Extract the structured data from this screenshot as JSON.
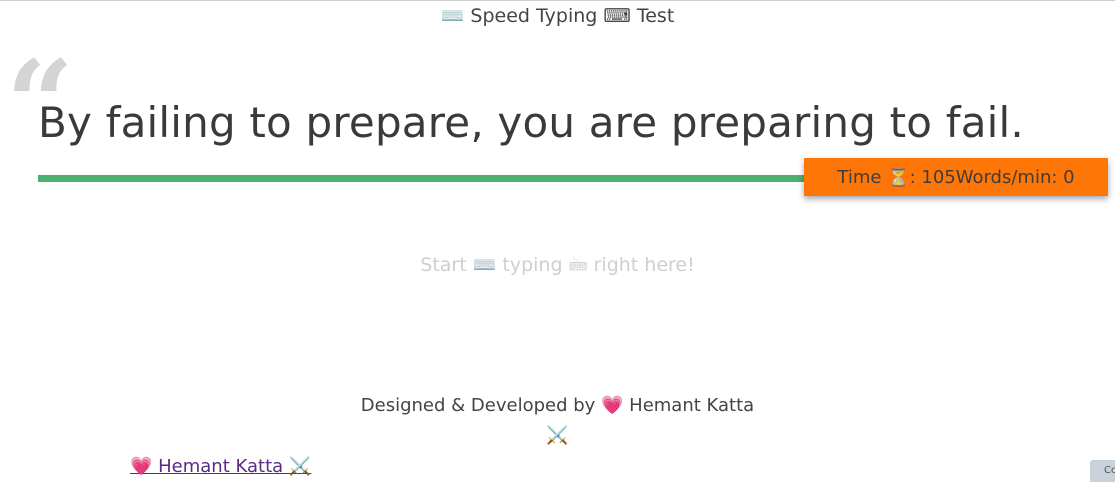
{
  "header": {
    "title": "⌨️ Speed Typing ⌨ Test"
  },
  "quote": {
    "mark": "“",
    "text": "By failing to prepare, you are preparing to fail."
  },
  "progress": {
    "fraction": 1.0,
    "color": "#4caf73"
  },
  "stats": {
    "text": "Time ⏳: 105Words/min: 0",
    "background": "#ff7608"
  },
  "input": {
    "placeholder": "Start ⌨️ typing 🖮 right here!"
  },
  "footer": {
    "credit": "Designed & Developed by 💗 Hemant Katta",
    "swords": "⚔️",
    "author_link": "💗 Hemant Katta ⚔️",
    "corner_label": "Co"
  }
}
